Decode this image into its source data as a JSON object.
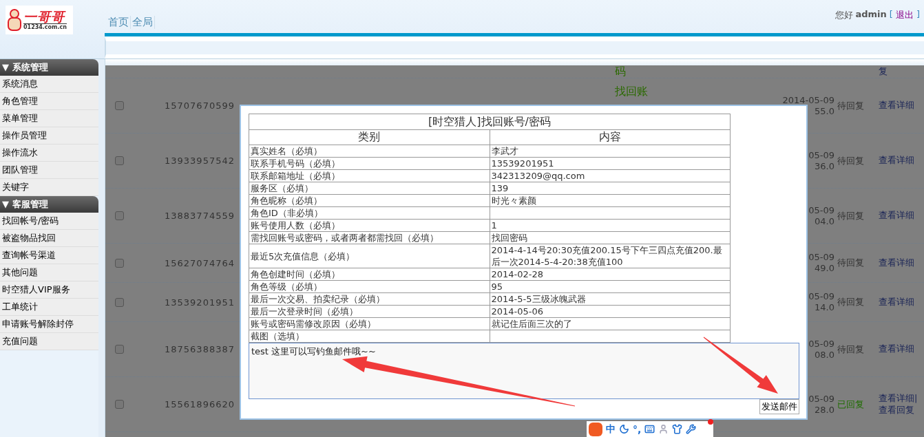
{
  "logo": {
    "name": "一哥哥",
    "domain": "01234.com.cn"
  },
  "nav": [
    "首页",
    "全局"
  ],
  "user": {
    "greeting": "您好",
    "name": "admin",
    "bracket_open": "[",
    "logout": "退出",
    "bracket_close": "]"
  },
  "sidebar": [
    {
      "title": "▼ 系统管理",
      "items": [
        "系统消息",
        "角色管理",
        "菜单管理",
        "操作员管理",
        "操作流水",
        "团队管理",
        "关键字"
      ]
    },
    {
      "title": "▼ 客服管理",
      "items": [
        "找回帐号/密码",
        "被盗物品找回",
        "查询帐号渠道",
        "其他问题",
        "时空猎人VIP服务",
        "工单统计",
        "申请账号解除封停",
        "充值问题"
      ]
    }
  ],
  "table": {
    "partial_row": {
      "type": "码",
      "action": "复"
    },
    "rows": [
      {
        "checked": false,
        "phone": "15707670599",
        "type": "找回账",
        "date": "2014-05-09",
        "time": "55.0",
        "status": "待回复",
        "replied": false,
        "actions": [
          "查看详细"
        ]
      },
      {
        "checked": false,
        "phone": "13933957542",
        "date": "05-09",
        "time": "36.0",
        "status": "待回复",
        "replied": false,
        "actions": [
          "查看详细"
        ]
      },
      {
        "checked": false,
        "phone": "13883774559",
        "date": "05-09",
        "time": "04.0",
        "status": "待回复",
        "replied": false,
        "actions": [
          "查看详细"
        ]
      },
      {
        "checked": false,
        "phone": "15627074764",
        "date": "05-09",
        "time": "49.0",
        "status": "待回复",
        "replied": false,
        "actions": [
          "查看详细"
        ]
      },
      {
        "checked": false,
        "phone": "13539201951",
        "date": "05-09",
        "time": "14.0",
        "status": "待回复",
        "replied": false,
        "actions": [
          "查看详细"
        ]
      },
      {
        "checked": false,
        "phone": "18756388387",
        "date": "05-09",
        "time": "08.0",
        "status": "待回复",
        "replied": false,
        "actions": [
          "查看详细"
        ]
      },
      {
        "checked": false,
        "phone": "15561896620",
        "date": "05-09",
        "time": "28.0",
        "status": "已回复",
        "replied": true,
        "actions": [
          "查看详细",
          "|",
          "查看回复"
        ]
      }
    ]
  },
  "dialog": {
    "title": "[时空猎人]找回账号/密码",
    "headers": [
      "类别",
      "内容"
    ],
    "rows": [
      [
        "真实姓名（必填）",
        "李武才"
      ],
      [
        "联系手机号码（必填）",
        "13539201951"
      ],
      [
        "联系邮箱地址（必填）",
        "342313209@qq.com"
      ],
      [
        "服务区（必填）",
        "139"
      ],
      [
        "角色昵称（必填）",
        "时光々素颜"
      ],
      [
        "角色ID（非必填）",
        ""
      ],
      [
        "账号使用人数（必填）",
        "1"
      ],
      [
        "需找回账号或密码，或者两者都需找回（必填）",
        "找回密码"
      ],
      [
        "最近5次充值信息（必填）",
        "2014-4-14号20:30充值200.15号下午三四点充值200.最后一次2014-5-4-20:38充值100"
      ],
      [
        "角色创建时间（必填）",
        "2014-02-28"
      ],
      [
        "角色等级（必填）",
        "95"
      ],
      [
        "最后一次交易、拍卖纪录（必填）",
        "2014-5-5三级冰魄武器"
      ],
      [
        "最后一次登录时间（必填）",
        "2014-05-06"
      ],
      [
        "账号或密码需修改原因（必填）",
        "就记住后面三次的了"
      ],
      [
        "截图（选填）",
        ""
      ]
    ],
    "message": "test 这里可以写钓鱼邮件哦~~",
    "send_button": "发送邮件"
  },
  "ime": {
    "mode": "中",
    "punct": "°,"
  }
}
